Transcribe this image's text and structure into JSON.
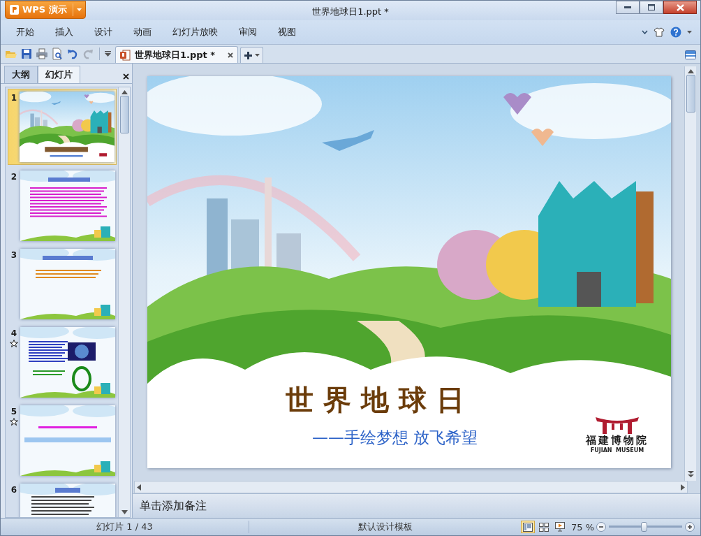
{
  "app_button": {
    "label": "WPS 演示"
  },
  "window": {
    "title": "世界地球日1.ppt *"
  },
  "menu": [
    {
      "label": "开始"
    },
    {
      "label": "插入"
    },
    {
      "label": "设计"
    },
    {
      "label": "动画"
    },
    {
      "label": "幻灯片放映"
    },
    {
      "label": "审阅"
    },
    {
      "label": "视图"
    }
  ],
  "document_tabs": [
    {
      "label": "世界地球日1.ppt *",
      "selected": true
    }
  ],
  "side_panel": {
    "tabs": [
      {
        "label": "大纲",
        "selected": false
      },
      {
        "label": "幻灯片",
        "selected": true
      }
    ],
    "slides": [
      {
        "number": "1",
        "selected": true,
        "animated": false,
        "kind": "title"
      },
      {
        "number": "2",
        "selected": false,
        "animated": false,
        "kind": "text"
      },
      {
        "number": "3",
        "selected": false,
        "animated": false,
        "kind": "quote"
      },
      {
        "number": "4",
        "selected": false,
        "animated": true
      },
      {
        "number": "5",
        "selected": false,
        "animated": true,
        "kind": "banner"
      },
      {
        "number": "6",
        "selected": false,
        "animated": false,
        "kind": "list"
      }
    ]
  },
  "slide": {
    "title": "世 界 地 球 日",
    "subtitle": "——手绘梦想 放飞希望",
    "logo_text": "福建博物院",
    "logo_caption": "FUJIAN  MUSEUM"
  },
  "notes": {
    "placeholder": "单击添加备注"
  },
  "status_bar": {
    "slide_counter": "幻灯片 1 / 43",
    "template": "默认设计模板",
    "views": [
      {
        "kind": "normal",
        "selected": true
      },
      {
        "kind": "sorter",
        "selected": false
      },
      {
        "kind": "show",
        "selected": false
      }
    ],
    "zoom": "75 %",
    "zoom_slider": {
      "level": 0.48
    }
  }
}
